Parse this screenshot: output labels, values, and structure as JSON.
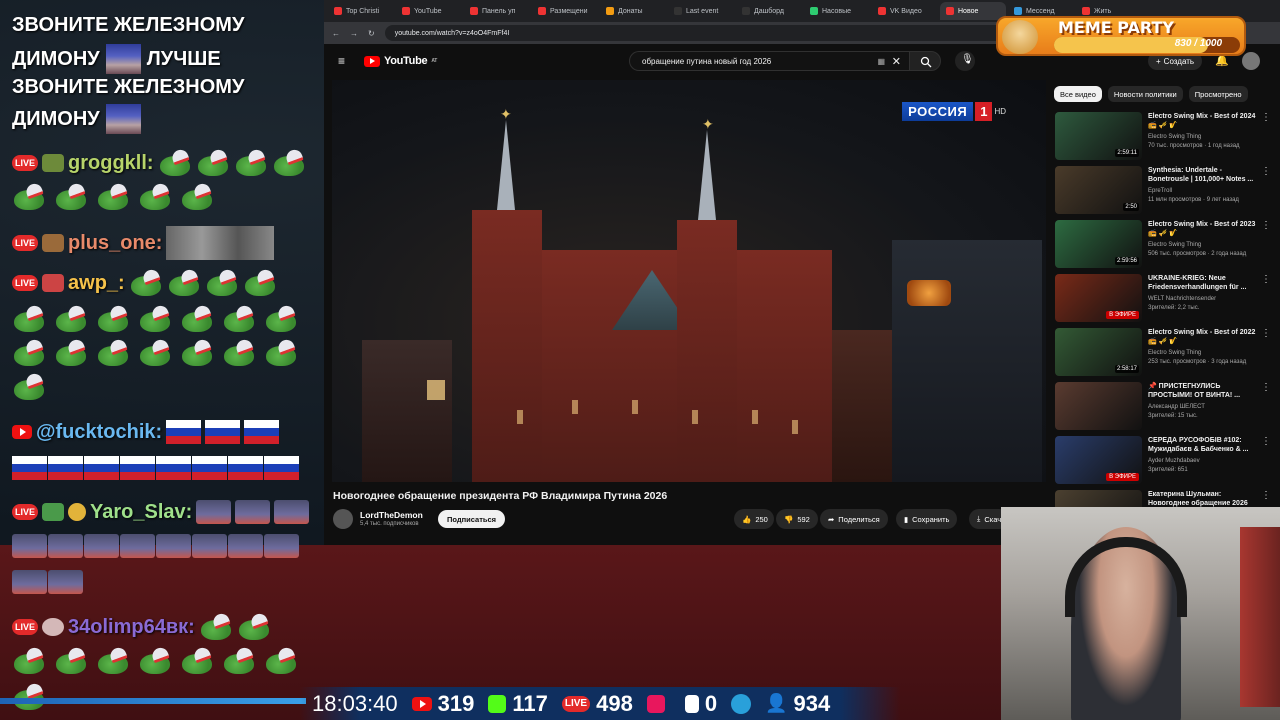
{
  "chat": {
    "message_lines": [
      "ЗВОНИТЕ ЖЕЛЕЗНОМУ",
      "ДИМОНУ",
      "ЛУЧШЕ",
      "ЗВОНИТЕ ЖЕЛЕЗНОМУ",
      "ДИМОНУ"
    ],
    "users": {
      "u1": "groggkll:",
      "u2": "plus_one:",
      "u3": "awp_:",
      "u4": "@fucktochik:",
      "u5": "Yaro_Slav:",
      "u6": "34olimp64вк:"
    },
    "live_badge": "LIVE"
  },
  "browser": {
    "tabs": [
      {
        "label": "Top Christi",
        "color": "#e33"
      },
      {
        "label": "YouTube",
        "color": "#e33"
      },
      {
        "label": "Панель уп",
        "color": "#e33"
      },
      {
        "label": "Размещени",
        "color": "#e33"
      },
      {
        "label": "Донаты",
        "color": "#f39c12"
      },
      {
        "label": "Last event",
        "color": "#333"
      },
      {
        "label": "Дашборд",
        "color": "#333"
      },
      {
        "label": "Насовые",
        "color": "#2ecc71"
      },
      {
        "label": "VK Видео",
        "color": "#e33"
      },
      {
        "label": "Новое",
        "color": "#e33"
      },
      {
        "label": "Мессенд",
        "color": "#3498db"
      },
      {
        "label": "Жить",
        "color": "#e33"
      }
    ],
    "url": "youtube.com/watch?v=z4oO4FmFf4I"
  },
  "youtube": {
    "logo_text": "YouTube",
    "logo_sup": "AT",
    "search_query": "обращение путина новый год 2026",
    "create_label": "Создать",
    "video_title": "Новогоднее обращение президента РФ Владимира Путина 2026",
    "channel_name": "LordTheDemon",
    "channel_subs": "5,4 тыс. подписчиков",
    "subscribe_label": "Подписаться",
    "likes": "250",
    "dislikes": "592",
    "share_label": "Поделиться",
    "save_label": "Сохранить",
    "download_label": "Скач",
    "broadcaster_logo": "РОССИЯ",
    "broadcaster_num": "1",
    "broadcaster_hd": "HD",
    "chips": [
      "Все видео",
      "Новости политики",
      "Просмотрено"
    ],
    "recommendations": [
      {
        "title": "Electro Swing Mix - Best of 2024 📻 🎺 🎷",
        "channel": "Electro Swing Thing",
        "meta": "70 тыс. просмотров · 1 год назад",
        "duration": "2:59:11",
        "thumb": "#2e5a3e"
      },
      {
        "title": "Synthesia: Undertale - Bonetrousle | 101,000+ Notes ...",
        "channel": "EpreTroll",
        "meta": "11 млн просмотров · 9 лет назад",
        "duration": "2:50",
        "thumb": "#4a3b2a"
      },
      {
        "title": "Electro Swing Mix - Best of 2023 📻 🎺 🎷",
        "channel": "Electro Swing Thing",
        "meta": "506 тыс. просмотров · 2 года назад",
        "duration": "2:59:56",
        "thumb": "#2d6b41"
      },
      {
        "title": "UKRAINE-KRIEG: Neue Friedensverhandlungen für ...",
        "channel": "WELT Nachrichtensender",
        "meta": "Зрителей: 2,2 тыс.",
        "live": "В ЭФИРЕ",
        "thumb": "#7a2a18"
      },
      {
        "title": "Electro Swing Mix - Best of 2022 📻 🎺 🎷",
        "channel": "Electro Swing Thing",
        "meta": "253 тыс. просмотров · 3 года назад",
        "duration": "2:58:17",
        "thumb": "#335a35"
      },
      {
        "title": "📌 ПРИСТЕГНУЛИСЬ ПРОСТЫМИ! ОТ ВИНТА! ...",
        "channel": "Александр ШЕЛЕСТ",
        "meta": "Зрителей: 15 тыс.",
        "live": "",
        "thumb": "#5a3b30"
      },
      {
        "title": "СЕРЕДА РУСОФОБІВ #102: Мужидабаєв & Бабченко & ...",
        "channel": "Ayder Muzhdabaev",
        "meta": "Зрителей: 651",
        "live": "В ЭФИРЕ",
        "thumb": "#2a3d6b"
      },
      {
        "title": "Екатерина Шульман: Новогоднее обращение 2026",
        "channel": "",
        "meta": "",
        "thumb": "#4b4030"
      }
    ]
  },
  "overlay": {
    "meme_title": "MEME PARTY",
    "meme_count": "830 / 1000",
    "meme_progress": 0.83,
    "time": "18:03:40",
    "youtube_viewers": "319",
    "kick_viewers": "117",
    "vk_viewers": "498",
    "rutube_viewers": "0",
    "total_viewers": "934"
  }
}
